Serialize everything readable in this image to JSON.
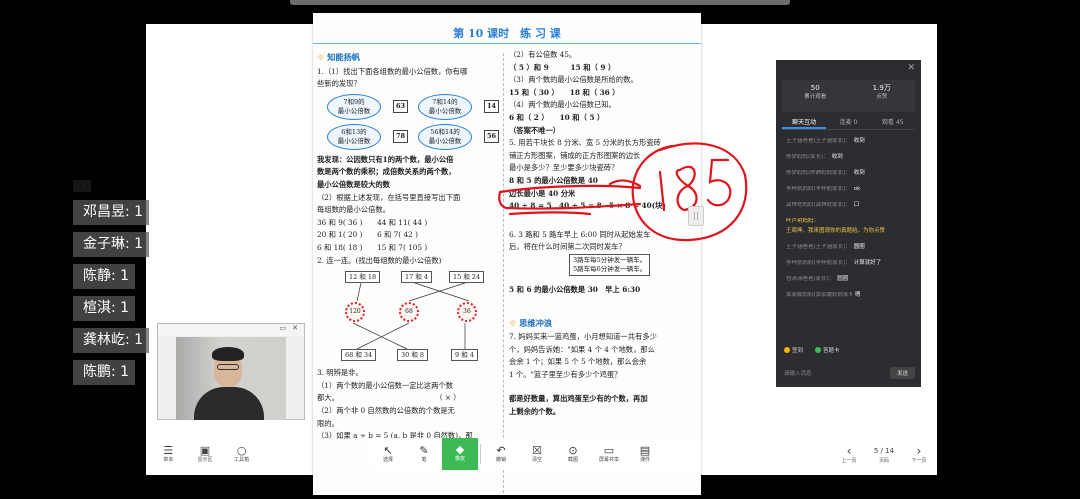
{
  "doc": {
    "title": "第 10 课时　练 习 课",
    "left": {
      "section": "知能扬帆",
      "q1": "1.（1）找出下面各组数的最小公倍数，你有哪",
      "q1b": "些新的发现？",
      "bubbles": [
        {
          "text": "7和9的\n最小公倍数",
          "ans": "63"
        },
        {
          "text": "7和14的\n最小公倍数",
          "ans": "14"
        },
        {
          "text": "6和13的\n最小公倍数",
          "ans": "78"
        },
        {
          "text": "56和14的\n最小公倍数",
          "ans": "56"
        }
      ],
      "found1": "我发现：公因数只有1的两个数，最小公倍",
      "found2": "数是两个数的乘积；成倍数关系的两个数，",
      "found3": "最小公倍数是较大的数",
      "q1c": "（2）根据上述发现，在括号里直接写出下面",
      "q1d": "每组数的最小公倍数。",
      "pairs1": "36 和 9(  36  )　　44 和 11(  44  )",
      "pairs2": "20 和 1(  20  )　　6 和 7(  42  )",
      "pairs3": "6 和 18(  18  )　　15 和 7( 105 )",
      "q2": "2. 连一连。(找出每组数的最小公倍数)",
      "top_boxes": [
        "12 和 18",
        "17 和 4",
        "15 和 24"
      ],
      "gears": [
        "120",
        "68",
        "36"
      ],
      "bottom_boxes": [
        "68 和 34",
        "30 和 8",
        "9 和 4"
      ],
      "q3": "3. 明辨是非。",
      "q3a": "（1）两个数的最小公倍数一定比这两个数",
      "q3a2": "都大。",
      "q3a_mark": "（ × ）",
      "q3b": "（2）两个非 0 自然数的公倍数的个数是无",
      "q3b2": "限的。",
      "q3c": "（3）如果 a ÷ b = 5 (a, b 是非 0 自然数)，那",
      "q3c_mark": "（ √ ）"
    },
    "right": {
      "r1": "（2）有公倍数 45。",
      "r2": "（ 5 ）和 9　　　15 和（  9  ）",
      "r3": "（3）两个数的最小公倍数是所给的数。",
      "r4": "15 和（ 30 ）　　18 和（ 36 ）",
      "r5": "（4）两个数的最小公倍数已知。",
      "r6": "6 和（  2  ）　　10 和（  5  ）",
      "r7": "（答案不唯一）",
      "q5": "5. 用若干块长 8 分米、宽 5 分米的长方形瓷砖",
      "q5b": "铺正方形图案，铺成的正方形图案的边长",
      "q5c": "最小是多少？至少要多少块瓷砖？",
      "q5d": "8 和 5 的最小公倍数是 40",
      "q5e": "边长最小是 40 分米",
      "q5f": "40 ÷ 8 = 5　40 ÷ 5 = 8　5 × 8 = 40(块)",
      "q6": "6. 3 路和 5 路车早上 6:00 同时从起始发车",
      "q6b": "后，将在什么时间第二次同时发车？",
      "q6c1": "3路车每5分钟发一辆车。",
      "q6c2": "5路车每6分钟发一辆车。",
      "q6ans": "5 和 6 的最小公倍数是 30　早上 6:30",
      "section2": "思维冲浪",
      "q7": "7. 妈妈买来一篮鸡蛋，小月想知道一共有多少",
      "q7b": "个，妈妈告诉她：\"如果 4 个 4 个地数，那么",
      "q7c": "会余 1 个；如果 5 个 5 个地数，那么会余",
      "q7d": "1 个。\"篮子里至少有多少个鸡蛋？",
      "q7e": "都是好数量，算出鸡蛋至少有的个数，再加",
      "q7f": "上剩余的个数。"
    }
  },
  "ink_annotation": "185",
  "doc_toolbar": [
    {
      "icon": "pointer-icon",
      "glyph": "↖",
      "label": "选择"
    },
    {
      "icon": "pen-icon",
      "glyph": "✎",
      "label": "笔"
    },
    {
      "icon": "eraser-icon",
      "glyph": "◆",
      "label": "橡皮"
    },
    {
      "icon": "undo-icon",
      "glyph": "↶",
      "label": "撤销"
    },
    {
      "icon": "clear-icon",
      "glyph": "☒",
      "label": "清空"
    },
    {
      "icon": "camera-icon",
      "glyph": "⊙",
      "label": "截图"
    },
    {
      "icon": "screen-icon",
      "glyph": "▭",
      "label": "屏幕共享"
    },
    {
      "icon": "doc-icon",
      "glyph": "▤",
      "label": "课件"
    }
  ],
  "left_tools": [
    {
      "icon": "menu-icon",
      "glyph": "☰",
      "label": "菜单"
    },
    {
      "icon": "whiteboard-icon",
      "glyph": "▣",
      "label": "显示区"
    },
    {
      "icon": "circle-icon",
      "glyph": "○",
      "label": "工具箱"
    }
  ],
  "pager": {
    "prev_label": "上一页",
    "page": "5 / 14",
    "page_label": "页码",
    "next_label": "下一页"
  },
  "panel": {
    "stat1_value": "50",
    "stat1_label": "累计观看",
    "stat2_value": "1.9万",
    "stat2_label": "点赞",
    "tabs": [
      "聊天互动",
      "连麦 0",
      "观看 45"
    ],
    "messages": [
      {
        "name": "王子涵爸爸(王子涵家长)：",
        "text": "收到",
        "hl": false
      },
      {
        "name": "陈梦妈妈(家长)：",
        "text": "收到",
        "hl": false
      },
      {
        "name": "陈梦妈妈(陈静妈妈家长)：",
        "text": "收到",
        "hl": false
      },
      {
        "name": "李梓航妈妈(李梓航家长)：",
        "text": "ok",
        "hl": false
      },
      {
        "name": "龚林屹妈妈(龚林屹家长)：",
        "text": "口",
        "hl": false
      },
      {
        "name": "叶卢玥妈妈：",
        "text": "王周坤、我来图观你的真题给。为你点赞",
        "hl": true
      },
      {
        "name": "王子涵爸爸(王子涵家长)：",
        "text": "圆圈",
        "hl": false
      },
      {
        "name": "李梓航妈妈(李梓航家长)：",
        "text": "计算就好了",
        "hl": false
      },
      {
        "name": "包涛涛爸爸(家长)：",
        "text": "圆圈",
        "hl": false
      },
      {
        "name": "黄家媛妈妈(黄家媛妈妈家长)：",
        "text": "嗯",
        "hl": false
      }
    ],
    "btn_sign": "签到",
    "btn_answer": "答题卡",
    "input_placeholder": "请输入消息",
    "send": "发送"
  },
  "names": [
    "邓昌昱: 1",
    "金子琳: 1",
    "陈静: 1",
    "楦淇: 1",
    "龚林屹: 1",
    "陈鹏: 1"
  ],
  "colors": {
    "accent_green": "#3cba54",
    "panel_bg": "#2c2d30",
    "ink_red": "#e0141c",
    "title_blue": "#2a7fd8"
  }
}
